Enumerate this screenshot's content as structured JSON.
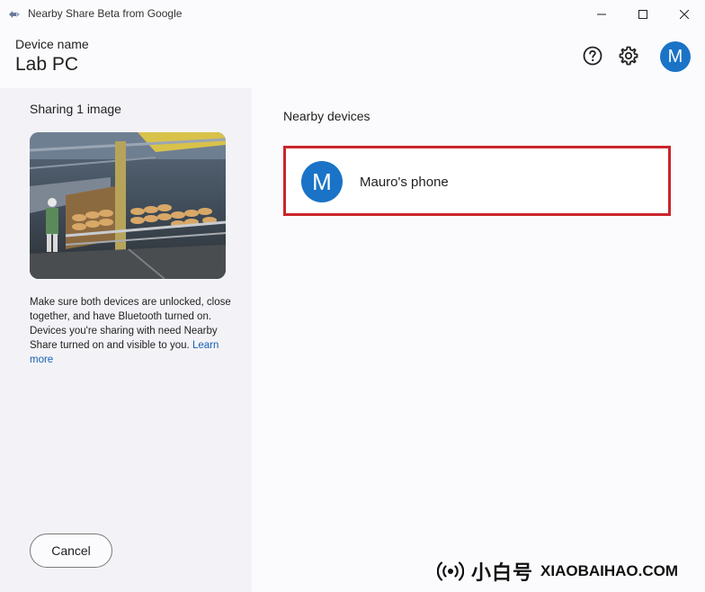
{
  "window": {
    "title": "Nearby Share Beta from Google"
  },
  "header": {
    "device_label": "Device name",
    "device_name": "Lab PC",
    "avatar_letter": "M"
  },
  "left_panel": {
    "sharing_title": "Sharing 1 image",
    "info_text": "Make sure both devices are unlocked, close together, and have Bluetooth turned on. Devices you're sharing with need Nearby Share turned on and visible to you.",
    "learn_more": "Learn more",
    "cancel_label": "Cancel"
  },
  "nearby": {
    "title": "Nearby devices",
    "devices": [
      {
        "name": "Mauro's phone",
        "avatar_letter": "M"
      }
    ]
  },
  "watermark": {
    "brand": "小白号",
    "site": "XIAOBAIHAO.COM"
  },
  "colors": {
    "accent": "#1a73c6",
    "highlight_border": "#c9252c",
    "link": "#1a5fb4"
  },
  "icons": {
    "app": "nearby-share-icon",
    "help": "help-circle-icon",
    "settings": "gear-icon",
    "minimize": "minimize-icon",
    "maximize": "maximize-icon",
    "close": "close-icon",
    "watermark": "broadcast-icon"
  }
}
